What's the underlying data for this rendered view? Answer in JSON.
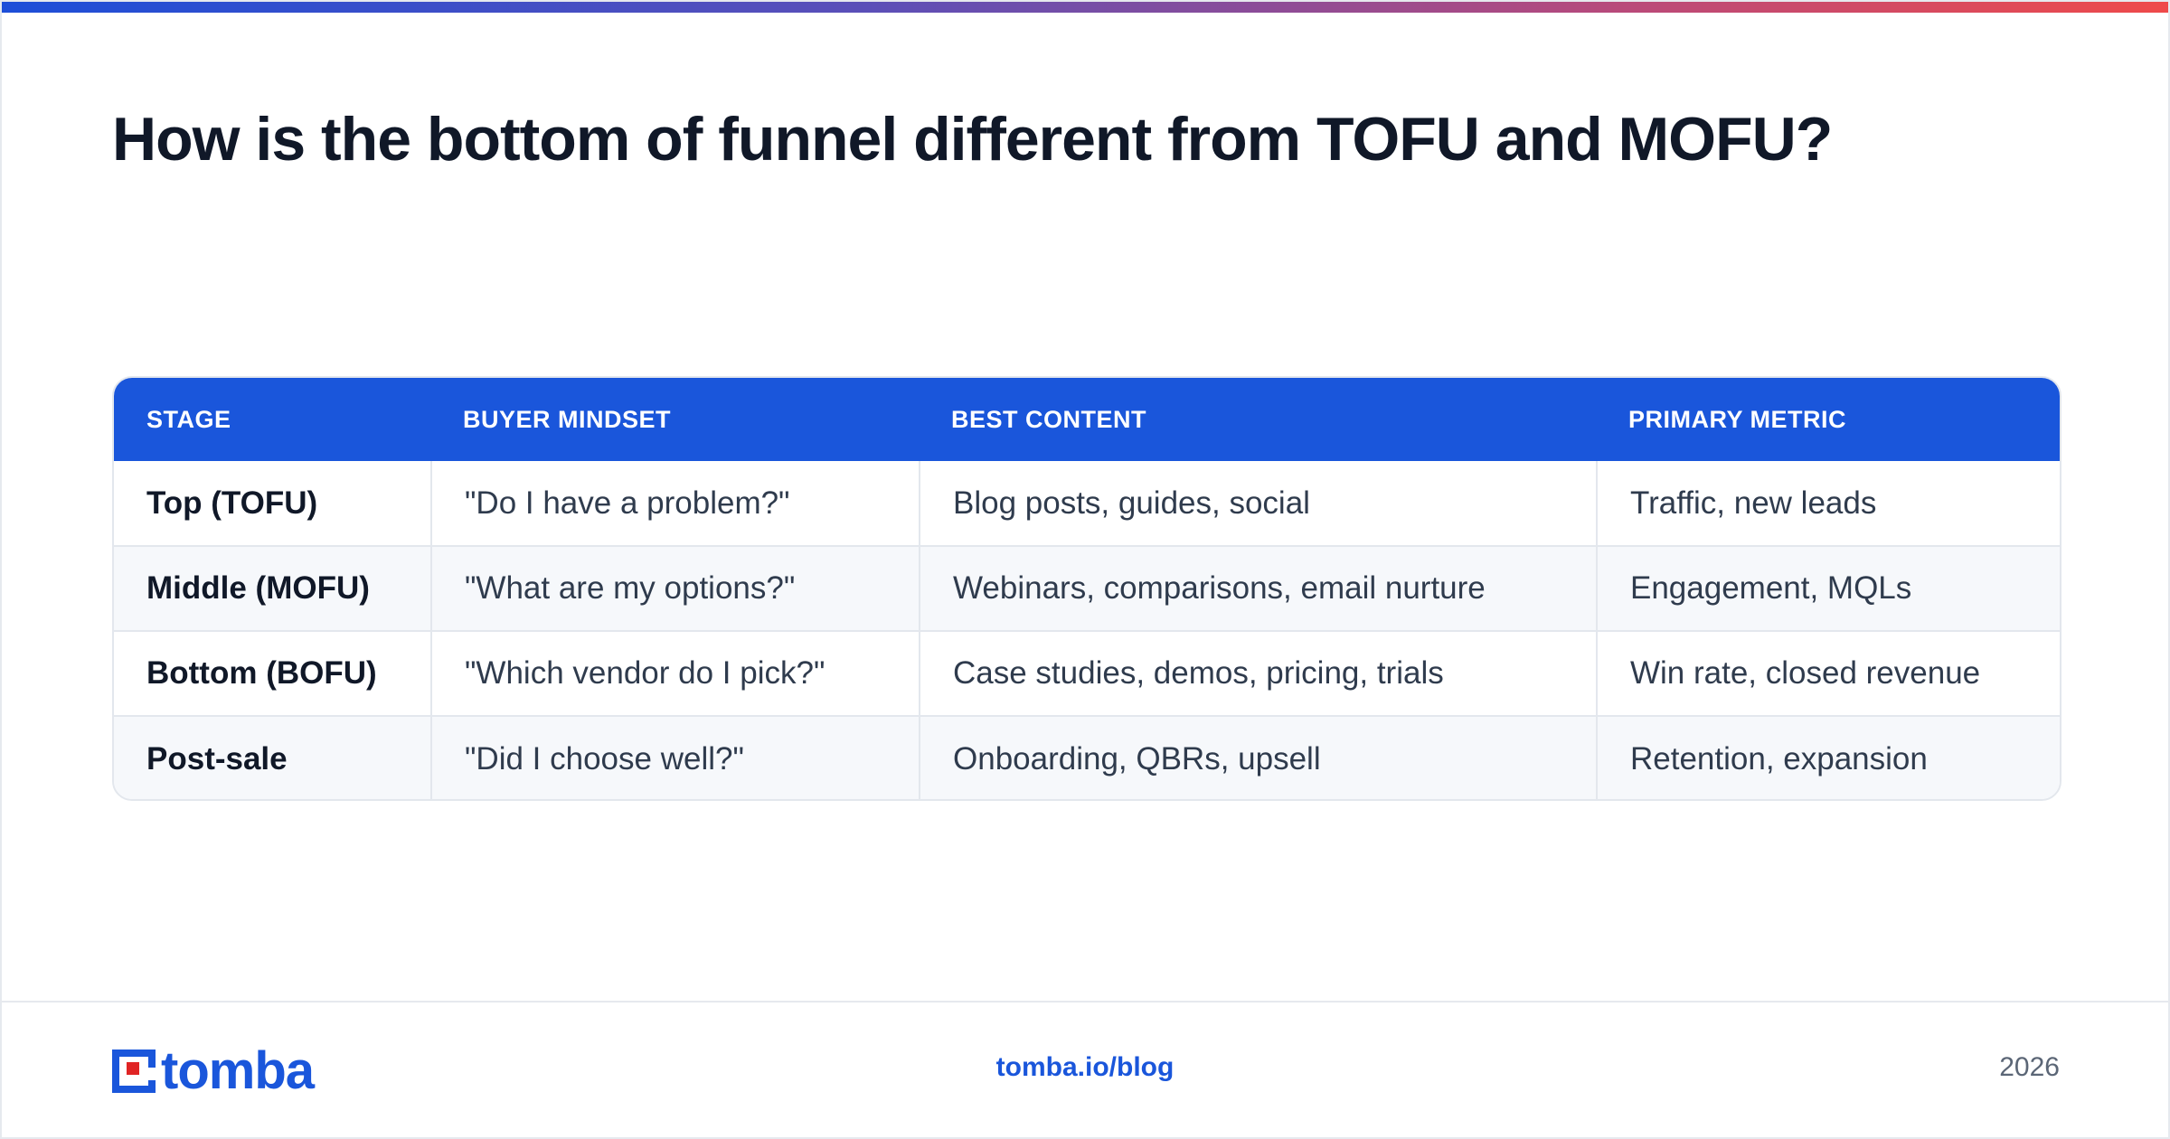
{
  "title": "How is the bottom of funnel different from TOFU and MOFU?",
  "colors": {
    "accent": "#1a56db",
    "logo_dot": "#e02424",
    "gradient": [
      "#1d4ed8",
      "#ef4a4a"
    ]
  },
  "table": {
    "headers": [
      "STAGE",
      "BUYER MINDSET",
      "BEST CONTENT",
      "PRIMARY METRIC"
    ],
    "rows": [
      [
        "Top (TOFU)",
        "\"Do I have a problem?\"",
        "Blog posts, guides, social",
        "Traffic, new leads"
      ],
      [
        "Middle (MOFU)",
        "\"What are my options?\"",
        "Webinars, comparisons, email nurture",
        "Engagement, MQLs"
      ],
      [
        "Bottom (BOFU)",
        "\"Which vendor do I pick?\"",
        "Case studies, demos, pricing, trials",
        "Win rate, closed revenue"
      ],
      [
        "Post-sale",
        "\"Did I choose well?\"",
        "Onboarding, QBRs, upsell",
        "Retention, expansion"
      ]
    ]
  },
  "footer": {
    "logo_text": "tomba",
    "link": "tomba.io/blog",
    "year": "2026"
  }
}
